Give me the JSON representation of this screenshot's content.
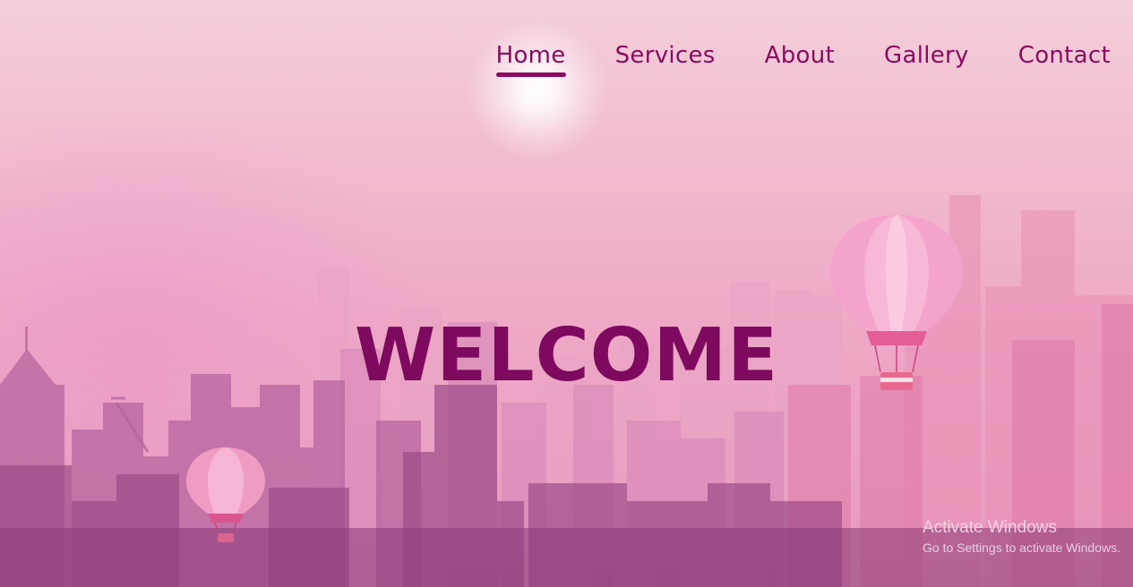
{
  "nav": {
    "items": [
      {
        "label": "Home",
        "active": true
      },
      {
        "label": "Services",
        "active": false
      },
      {
        "label": "About",
        "active": false
      },
      {
        "label": "Gallery",
        "active": false
      },
      {
        "label": "Contact",
        "active": false
      }
    ]
  },
  "hero": {
    "heading": "WELCOME",
    "background_description_icons": [
      "sun-glow",
      "city-skyline",
      "hot-air-balloon-large",
      "hot-air-balloon-small"
    ]
  },
  "watermark": {
    "title": "Activate Windows",
    "subtitle": "Go to Settings to activate Windows."
  },
  "colors": {
    "accent": "#8a0a62",
    "heading": "#7d0a5e",
    "background_top": "#f4cfd9",
    "background_bottom": "#e59abd"
  }
}
